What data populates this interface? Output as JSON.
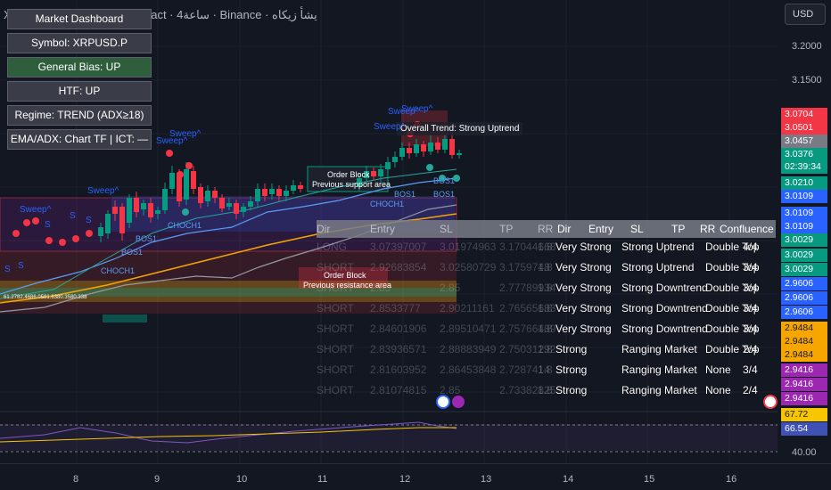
{
  "header": {
    "title": "XRP PerpetualFutures Contract · 4ساعة · Binance · يشأ زيكاه",
    "currency_label": "USD"
  },
  "dashboard": {
    "rows": [
      {
        "label": "Market Dashboard",
        "highlight": false
      },
      {
        "label": "Symbol: XRPUSD.P",
        "highlight": false
      },
      {
        "label": "General Bias: UP",
        "highlight": true
      },
      {
        "label": "HTF: UP",
        "highlight": false
      },
      {
        "label": "Regime: TREND (ADX≥18)",
        "highlight": false
      },
      {
        "label": "EMA/ADX: Chart TF  |  ICT: —",
        "highlight": false
      }
    ]
  },
  "annotations": {
    "trend_label": "Overall Trend: Strong Uptrend",
    "order_block_top": "Order Block",
    "order_block_top_sub": "Previous support area",
    "order_block_bottom": "Order Block",
    "order_block_bottom_sub": "Previous resistance area",
    "sweep_label": "Sweep^",
    "bos_label": "BOS1",
    "choch_label": "CHOCH1",
    "s_label": "S",
    "fib_text": "61.2782.4686.0581.6380.3580.338"
  },
  "stats_table": {
    "ghost_headers": [
      "Dir",
      "Entry",
      "SL",
      "TP",
      "RR"
    ],
    "headers": [
      "Dir",
      "Entry",
      "SL",
      "TP",
      "RR",
      "Confluence"
    ],
    "ghost_rows": [
      [
        "LONG",
        "3.07397007",
        "3.01974963",
        "3.17044668",
        "1.8"
      ],
      [
        "SHORT",
        "2.92683854",
        "3.02580729",
        "3.1759748",
        "1.8"
      ],
      [
        "SHORT",
        "2.85",
        "2.85",
        "2.77789934",
        "1.8"
      ],
      [
        "SHORT",
        "2.8533777",
        "2.90211161",
        "2.76565683",
        "1.8"
      ],
      [
        "SHORT",
        "2.84601906",
        "2.89510471",
        "2.75766489",
        "1.8"
      ],
      [
        "SHORT",
        "2.83936571",
        "2.88883949",
        "2.75031292",
        "1.8"
      ],
      [
        "SHORT",
        "2.81603952",
        "2.86453848",
        "2.7287414",
        "1.8"
      ],
      [
        "SHORT",
        "2.81074815",
        "2.85",
        "2.73382825",
        "1.8"
      ]
    ],
    "rows": [
      [
        "Very Strong",
        "Strong Uptrend",
        "Double Top",
        "4/4"
      ],
      [
        "Very Strong",
        "Strong Uptrend",
        "Double Top",
        "3/4"
      ],
      [
        "Very Strong",
        "Strong Downtrend",
        "Double Top",
        "3/4"
      ],
      [
        "Very Strong",
        "Strong Downtrend",
        "Double Top",
        "3/4"
      ],
      [
        "Very Strong",
        "Strong Downtrend",
        "Double Top",
        "3/4"
      ],
      [
        "Strong",
        "Ranging Market",
        "Double Top",
        "2/4"
      ],
      [
        "Strong",
        "Ranging Market",
        "None",
        "3/4"
      ],
      [
        "Strong",
        "Ranging Market",
        "None",
        "2/4"
      ]
    ]
  },
  "price_axis": {
    "labels": [
      "3.2000",
      "3.1500",
      "40.00"
    ],
    "tags": [
      {
        "text": "3.0704",
        "color": "#f23645"
      },
      {
        "text": "3.0501",
        "color": "#f23645"
      },
      {
        "text": "3.0457",
        "color": "#787b86"
      },
      {
        "text": "3.0376",
        "color": "#089981"
      },
      {
        "text": "02:39:34",
        "color": "#089981"
      },
      {
        "text": "3.0210",
        "color": "#089981"
      },
      {
        "text": "3.0109",
        "color": "#2962ff"
      },
      {
        "text": "3.0109",
        "color": "#2962ff"
      },
      {
        "text": "3.0109",
        "color": "#2962ff"
      },
      {
        "text": "3.0029",
        "color": "#089981"
      },
      {
        "text": "3.0029",
        "color": "#089981"
      },
      {
        "text": "3.0029",
        "color": "#089981"
      },
      {
        "text": "2.9606",
        "color": "#2962ff"
      },
      {
        "text": "2.9606",
        "color": "#2962ff"
      },
      {
        "text": "2.9606",
        "color": "#2962ff"
      },
      {
        "text": "2.9484",
        "color": "#f7a600"
      },
      {
        "text": "2.9484",
        "color": "#f7a600"
      },
      {
        "text": "2.9484",
        "color": "#f7a600"
      },
      {
        "text": "2.9416",
        "color": "#9c27b0"
      },
      {
        "text": "2.9416",
        "color": "#9c27b0"
      },
      {
        "text": "2.9416",
        "color": "#9c27b0"
      },
      {
        "text": "67.72",
        "color": "#f7c600"
      },
      {
        "text": "66.54",
        "color": "#3f51b5"
      }
    ]
  },
  "time_axis": {
    "labels": [
      "8",
      "9",
      "10",
      "11",
      "12",
      "13",
      "14",
      "15",
      "16"
    ]
  },
  "colors": {
    "up": "#089981",
    "down": "#f23645",
    "sweep": "#2962ff",
    "ema_orange": "#f7a600",
    "background": "#131722"
  }
}
